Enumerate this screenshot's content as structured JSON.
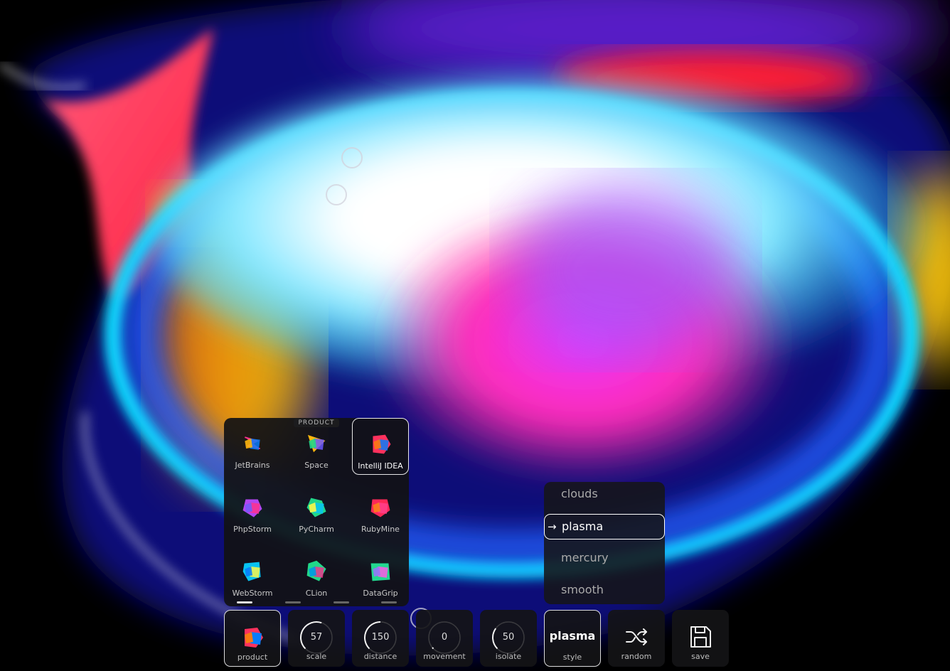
{
  "products": {
    "title": "PRODUCT",
    "items": [
      {
        "label": "JetBrains",
        "icon": "jetbrains-logo-icon",
        "colors": [
          "#ff318c",
          "#fdb60d",
          "#087cfa"
        ]
      },
      {
        "label": "Space",
        "icon": "space-logo-icon",
        "colors": [
          "#fdb60d",
          "#21d789",
          "#6b57ff"
        ]
      },
      {
        "label": "IntelliJ IDEA",
        "icon": "intellij-idea-logo-icon",
        "colors": [
          "#fe315d",
          "#f97a12",
          "#087cfa"
        ],
        "selected": true
      },
      {
        "label": "PhpStorm",
        "icon": "phpstorm-logo-icon",
        "colors": [
          "#b345f1",
          "#765af8",
          "#ff318c"
        ]
      },
      {
        "label": "PyCharm",
        "icon": "pycharm-logo-icon",
        "colors": [
          "#21d789",
          "#fcf84a",
          "#07c3f2"
        ]
      },
      {
        "label": "RubyMine",
        "icon": "rubymine-logo-icon",
        "colors": [
          "#fe2857",
          "#fc801d",
          "#ff3f8c"
        ]
      },
      {
        "label": "WebStorm",
        "icon": "webstorm-logo-icon",
        "colors": [
          "#07c3f2",
          "#087cfa",
          "#fcf84a"
        ]
      },
      {
        "label": "CLion",
        "icon": "clion-logo-icon",
        "colors": [
          "#21d789",
          "#009ae5",
          "#ed358c"
        ]
      },
      {
        "label": "DataGrip",
        "icon": "datagrip-logo-icon",
        "colors": [
          "#22d88f",
          "#9775f8",
          "#ff59e6"
        ]
      }
    ],
    "pages": 4,
    "active_page": 0
  },
  "style_menu": {
    "options": [
      "clouds",
      "plasma",
      "mercury",
      "smooth"
    ],
    "selected": "plasma",
    "arrow": "→"
  },
  "toolbar": {
    "product_label": "product",
    "scale": {
      "value": "57",
      "label": "scale",
      "level": 0.57
    },
    "distance": {
      "value": "150",
      "label": "distance",
      "level": 0.5
    },
    "movement": {
      "value": "0",
      "label": "movement",
      "level": 0.0
    },
    "isolate": {
      "value": "50",
      "label": "isolate",
      "level": 0.3
    },
    "style": {
      "value": "plasma",
      "label": "style"
    },
    "random_label": "random",
    "save_label": "save"
  },
  "colors": {
    "accent": "#ffffff",
    "panel": "#121214"
  }
}
